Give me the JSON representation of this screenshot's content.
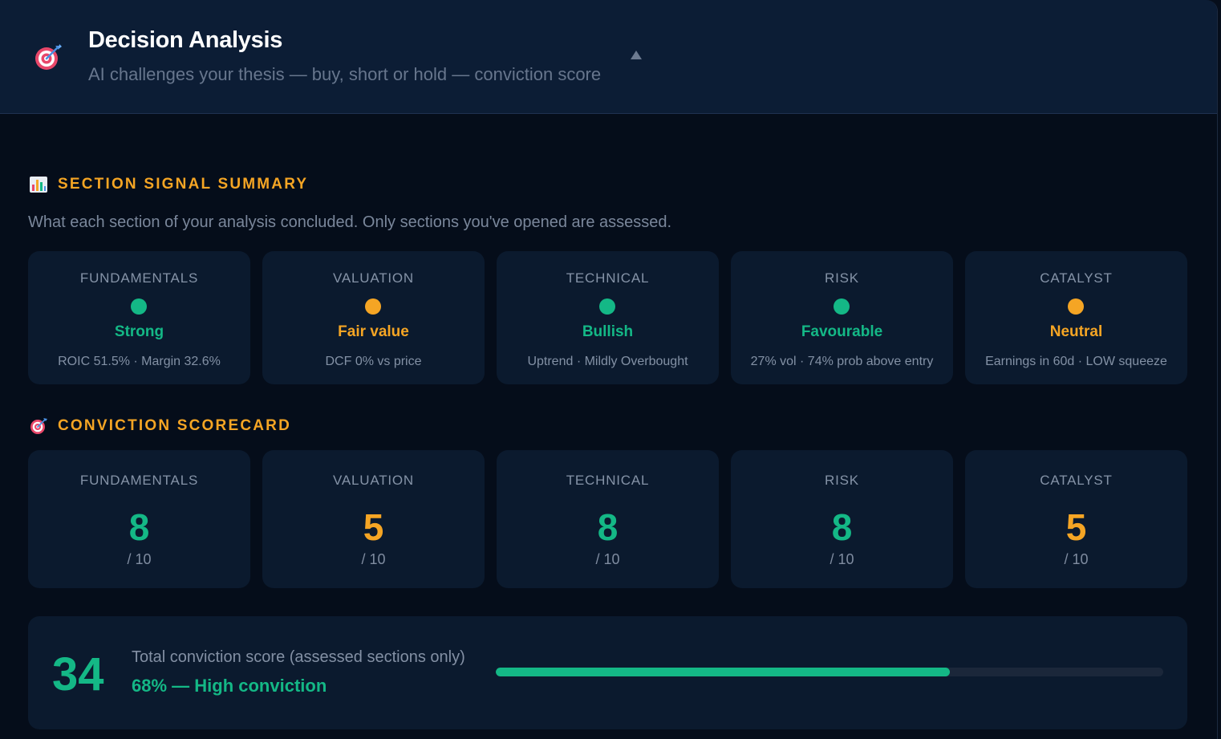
{
  "header": {
    "title": "Decision Analysis",
    "subtitle": "AI challenges your thesis — buy, short or hold — conviction score",
    "icon": "target-icon"
  },
  "colors": {
    "positive": "#14b886",
    "neutral": "#f5a524",
    "accent": "#f5a524"
  },
  "signal_summary": {
    "title": "SECTION SIGNAL SUMMARY",
    "icon": "bar-chart-icon",
    "description": "What each section of your analysis concluded. Only sections you've opened are assessed.",
    "cards": [
      {
        "label": "FUNDAMENTALS",
        "verdict": "Strong",
        "detail": "ROIC 51.5% · Margin 32.6%",
        "status": "positive"
      },
      {
        "label": "VALUATION",
        "verdict": "Fair value",
        "detail": "DCF 0% vs price",
        "status": "neutral"
      },
      {
        "label": "TECHNICAL",
        "verdict": "Bullish",
        "detail": "Uptrend · Mildly Overbought",
        "status": "positive"
      },
      {
        "label": "RISK",
        "verdict": "Favourable",
        "detail": "27% vol · 74% prob above entry",
        "status": "positive"
      },
      {
        "label": "CATALYST",
        "verdict": "Neutral",
        "detail": "Earnings in 60d · LOW squeeze",
        "status": "neutral"
      }
    ]
  },
  "scorecard": {
    "title": "CONVICTION SCORECARD",
    "icon": "target-icon",
    "cards": [
      {
        "label": "FUNDAMENTALS",
        "score": "8",
        "denom": "/ 10",
        "status": "positive"
      },
      {
        "label": "VALUATION",
        "score": "5",
        "denom": "/ 10",
        "status": "neutral"
      },
      {
        "label": "TECHNICAL",
        "score": "8",
        "denom": "/ 10",
        "status": "positive"
      },
      {
        "label": "RISK",
        "score": "8",
        "denom": "/ 10",
        "status": "positive"
      },
      {
        "label": "CATALYST",
        "score": "5",
        "denom": "/ 10",
        "status": "neutral"
      }
    ]
  },
  "total": {
    "score": "34",
    "label": "Total conviction score (assessed sections only)",
    "percent_text": "68% — High conviction",
    "progress": 0.68
  }
}
